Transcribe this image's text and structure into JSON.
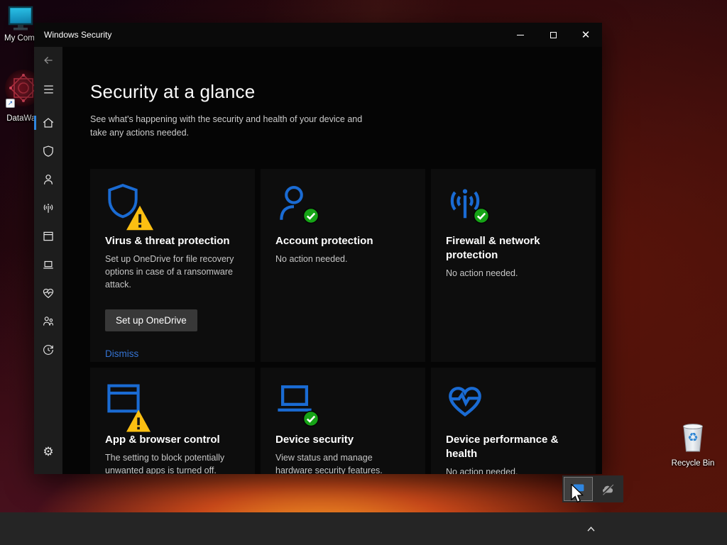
{
  "colors": {
    "accent_blue": "#2f86e0",
    "icon_blue": "#1a6bd3",
    "warning_yellow": "#fcbf12",
    "ok_green": "#16a316",
    "link_blue": "#3574d4",
    "taskbar_gray": "#252525"
  },
  "desktop": {
    "icons": [
      {
        "label": "My Computer"
      },
      {
        "label": "DataWag"
      },
      {
        "label": "Recycle Bin"
      }
    ]
  },
  "window": {
    "title": "Windows Security"
  },
  "sidebar": {
    "items": [
      "back",
      "menu",
      "home",
      "virus-threat-protection",
      "account-protection",
      "firewall-network-protection",
      "app-browser-control",
      "device-security",
      "device-performance-health",
      "family-options",
      "protection-history",
      "settings"
    ]
  },
  "main": {
    "heading": "Security at a glance",
    "subheading": "See what's happening with the security and health of your device and take any actions needed.",
    "tiles": [
      {
        "title": "Virus & threat protection",
        "description": "Set up OneDrive for file recovery options in case of a ransomware attack.",
        "status": "warning",
        "button": "Set up OneDrive",
        "link": "Dismiss"
      },
      {
        "title": "Account protection",
        "description": "No action needed.",
        "status": "ok"
      },
      {
        "title": "Firewall & network protection",
        "description": "No action needed.",
        "status": "ok"
      },
      {
        "title": "App & browser control",
        "description": "The setting to block potentially unwanted apps is turned off.",
        "status": "warning"
      },
      {
        "title": "Device security",
        "description": "View status and manage hardware security features.",
        "status": "ok"
      },
      {
        "title": "Device performance & health",
        "description": "No action needed.",
        "status": "none"
      }
    ]
  }
}
